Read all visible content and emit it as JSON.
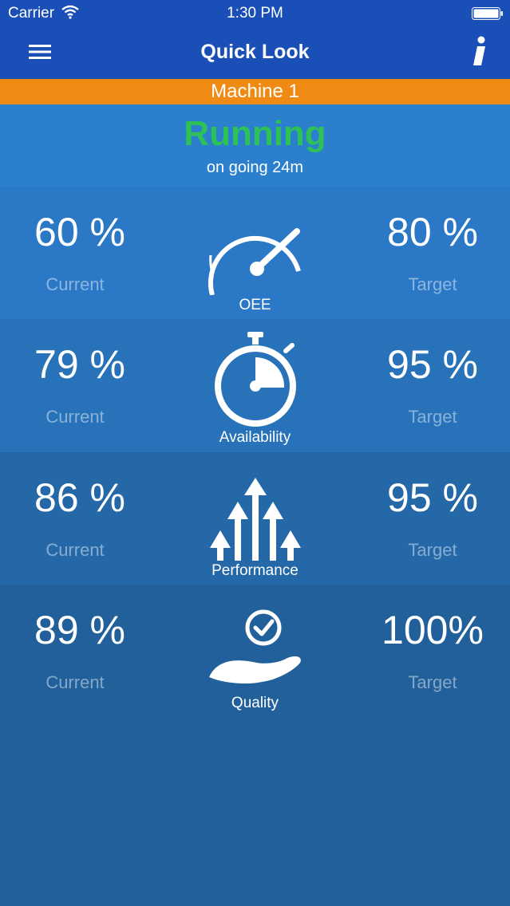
{
  "status_bar": {
    "carrier": "Carrier",
    "time": "1:30 PM"
  },
  "nav": {
    "title": "Quick Look"
  },
  "machine": {
    "name": "Machine 1"
  },
  "state": {
    "label": "Running",
    "duration": "on going 24m",
    "color": "#2ec157"
  },
  "metrics": [
    {
      "name": "OEE",
      "current": "60 %",
      "current_label": "Current",
      "target": "80 %",
      "target_label": "Target",
      "icon": "speedometer-icon"
    },
    {
      "name": "Availability",
      "current": "79 %",
      "current_label": "Current",
      "target": "95 %",
      "target_label": "Target",
      "icon": "stopwatch-icon"
    },
    {
      "name": "Performance",
      "current": "86 %",
      "current_label": "Current",
      "target": "95 %",
      "target_label": "Target",
      "icon": "up-arrows-icon"
    },
    {
      "name": "Quality",
      "current": "89 %",
      "current_label": "Current",
      "target": "100%",
      "target_label": "Target",
      "icon": "hand-check-icon"
    }
  ],
  "colors": {
    "nav": "#1a4fb8",
    "machine_bar": "#ef8a14",
    "running": "#2ec157"
  }
}
